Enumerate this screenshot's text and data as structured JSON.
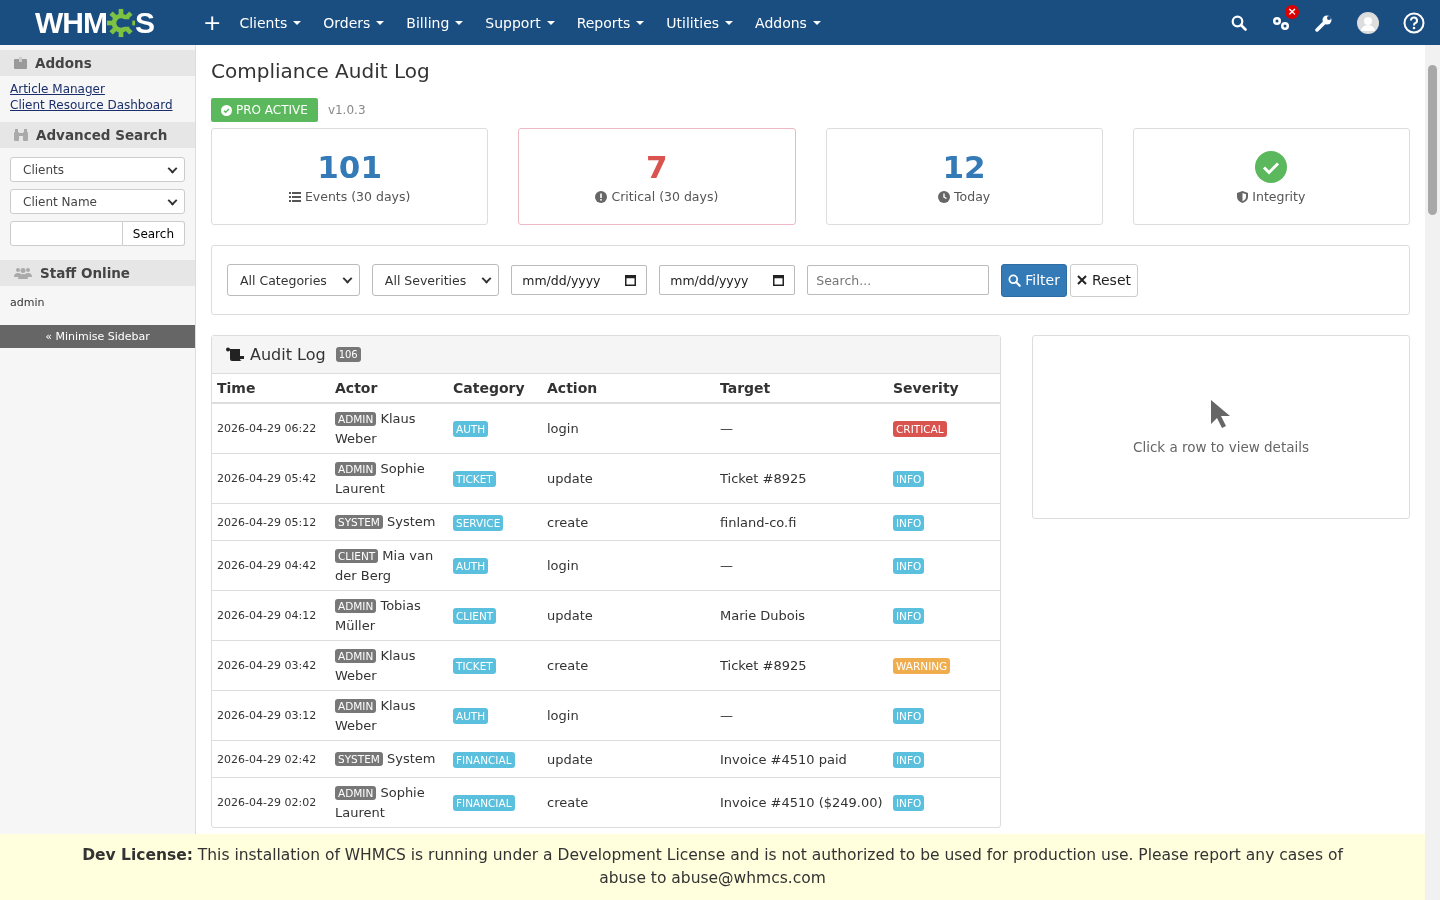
{
  "nav": {
    "logo_left": "WHM",
    "logo_right": "S",
    "add": "+",
    "menus": [
      {
        "label": "Clients"
      },
      {
        "label": "Orders"
      },
      {
        "label": "Billing"
      },
      {
        "label": "Support"
      },
      {
        "label": "Reports"
      },
      {
        "label": "Utilities"
      },
      {
        "label": "Addons"
      }
    ],
    "notification": "×"
  },
  "sidebar": {
    "addons_title": "Addons",
    "addons_links": [
      "Article Manager",
      "Client Resource Dashboard"
    ],
    "search_title": "Advanced Search",
    "search_type": "Clients",
    "search_field": "Client Name",
    "search_button": "Search",
    "staff_title": "Staff Online",
    "staff": [
      "admin"
    ],
    "minimise": "« Minimise Sidebar"
  },
  "page": {
    "title": "Compliance Audit Log",
    "badge": "PRO ACTIVE",
    "version": "v1.0.3"
  },
  "stats": [
    {
      "kind": "count",
      "value": "101",
      "label": "Events (30 days)",
      "color": "#337ab7",
      "highlighted": false
    },
    {
      "kind": "count",
      "value": "7",
      "label": "Critical (30 days)",
      "color": "#d9534f",
      "highlighted": true
    },
    {
      "kind": "count",
      "value": "12",
      "label": "Today",
      "color": "#337ab7",
      "highlighted": false
    },
    {
      "kind": "status",
      "label": "Integrity",
      "color": "#5cb85c",
      "highlighted": false
    }
  ],
  "filters": {
    "category": "All Categories",
    "severity": "All Severities",
    "date_from": "mm/dd/yyyy",
    "date_to": "mm/dd/yyyy",
    "search_placeholder": "Search...",
    "filter_button": "Filter",
    "reset_button": "Reset"
  },
  "audit_log": {
    "title": "Audit Log",
    "count": "106",
    "columns": [
      "Time",
      "Actor",
      "Category",
      "Action",
      "Target",
      "Severity"
    ],
    "rows": [
      {
        "time": "2026-04-29 06:22",
        "role": "ADMIN",
        "actor": "Klaus Weber",
        "category": "AUTH",
        "action": "login",
        "target": "—",
        "severity": {
          "label": "CRITICAL",
          "color": "#d9534f"
        }
      },
      {
        "time": "2026-04-29 05:42",
        "role": "ADMIN",
        "actor": "Sophie Laurent",
        "category": "TICKET",
        "action": "update",
        "target": "Ticket #8925",
        "severity": {
          "label": "INFO",
          "color": "#5bc0de"
        }
      },
      {
        "time": "2026-04-29 05:12",
        "role": "SYSTEM",
        "actor": "System",
        "category": "SERVICE",
        "action": "create",
        "target": "finland-co.fi",
        "severity": {
          "label": "INFO",
          "color": "#5bc0de"
        }
      },
      {
        "time": "2026-04-29 04:42",
        "role": "CLIENT",
        "actor": "Mia van der Berg",
        "category": "AUTH",
        "action": "login",
        "target": "—",
        "severity": {
          "label": "INFO",
          "color": "#5bc0de"
        }
      },
      {
        "time": "2026-04-29 04:12",
        "role": "ADMIN",
        "actor": "Tobias Müller",
        "category": "CLIENT",
        "action": "update",
        "target": "Marie Dubois",
        "severity": {
          "label": "INFO",
          "color": "#5bc0de"
        }
      },
      {
        "time": "2026-04-29 03:42",
        "role": "ADMIN",
        "actor": "Klaus Weber",
        "category": "TICKET",
        "action": "create",
        "target": "Ticket #8925",
        "severity": {
          "label": "WARNING",
          "color": "#f0ad4e"
        }
      },
      {
        "time": "2026-04-29 03:12",
        "role": "ADMIN",
        "actor": "Klaus Weber",
        "category": "AUTH",
        "action": "login",
        "target": "—",
        "severity": {
          "label": "INFO",
          "color": "#5bc0de"
        }
      },
      {
        "time": "2026-04-29 02:42",
        "role": "SYSTEM",
        "actor": "System",
        "category": "FINANCIAL",
        "action": "update",
        "target": "Invoice #4510 paid",
        "severity": {
          "label": "INFO",
          "color": "#5bc0de"
        }
      },
      {
        "time": "2026-04-29 02:02",
        "role": "ADMIN",
        "actor": "Sophie Laurent",
        "category": "FINANCIAL",
        "action": "create",
        "target": "Invoice #4510 ($249.00)",
        "severity": {
          "label": "INFO",
          "color": "#5bc0de"
        }
      }
    ]
  },
  "details": {
    "hint": "Click a row to view details"
  },
  "footer": {
    "text": "**Dev License:** This installation of WHMCS is running under a Development License and is not authorized to be used for production use. Please report any cases of abuse to abuse@whmcs.com"
  }
}
